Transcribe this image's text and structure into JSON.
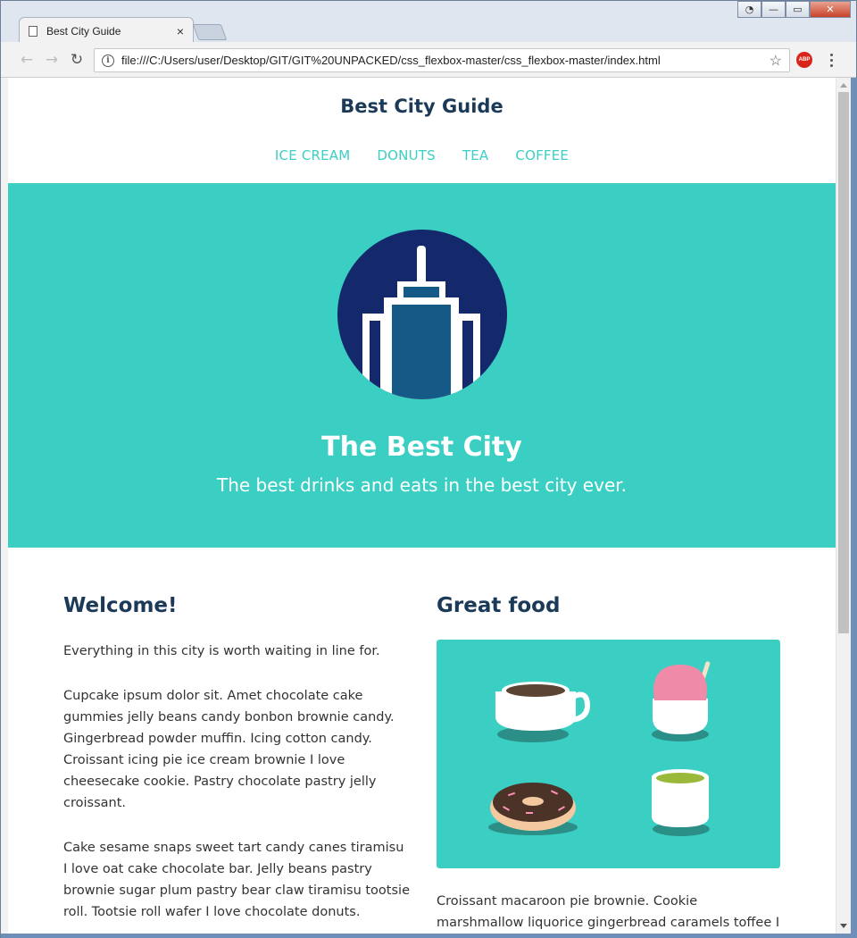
{
  "browser": {
    "tab_title": "Best City Guide",
    "tab_close": "×",
    "url": "file:///C:/Users/user/Desktop/GIT/GIT%20UNPACKED/css_flexbox-master/css_flexbox-master/index.html",
    "back_icon": "←",
    "forward_icon": "→",
    "reload_icon": "↻",
    "star_icon": "☆",
    "info_icon": "i",
    "abp_label": "ABP",
    "win_minimize": "—",
    "win_maximize": "▭",
    "win_close": "✕",
    "win_user": "◔"
  },
  "site": {
    "title": "Best City Guide",
    "nav": [
      "ICE CREAM",
      "DONUTS",
      "TEA",
      "COFFEE"
    ]
  },
  "hero": {
    "title": "The Best City",
    "subtitle": "The best drinks and eats in the best city ever."
  },
  "welcome": {
    "heading": "Welcome!",
    "p1": "Everything in this city is worth waiting in line for.",
    "p2": "Cupcake ipsum dolor sit. Amet chocolate cake gummies jelly beans candy bonbon brownie candy. Gingerbread powder muffin. Icing cotton candy. Croissant icing pie ice cream brownie I love cheesecake cookie. Pastry chocolate pastry jelly croissant.",
    "p3": "Cake sesame snaps sweet tart candy canes tiramisu I love oat cake chocolate bar. Jelly beans pastry brownie sugar plum pastry bear claw tiramisu tootsie roll. Tootsie roll wafer I love chocolate donuts."
  },
  "food": {
    "heading": "Great food",
    "para": "Croissant macaroon pie brownie. Cookie marshmallow liquorice gingerbread caramels toffee I"
  },
  "colors": {
    "teal": "#3bcfc4",
    "navy": "#1b3a57",
    "logo_circle": "#13296b",
    "logo_building": "#155a86"
  }
}
